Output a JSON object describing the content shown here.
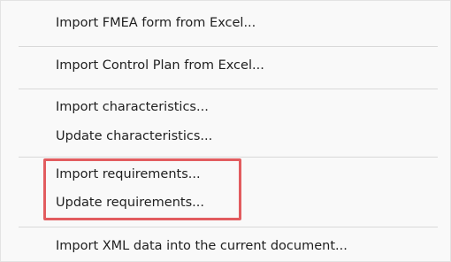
{
  "menu": {
    "items": [
      {
        "label": "Import FMEA form from Excel..."
      },
      {
        "label": "Import Control Plan from Excel..."
      },
      {
        "label": "Import characteristics..."
      },
      {
        "label": "Update characteristics..."
      },
      {
        "label": "Import requirements..."
      },
      {
        "label": "Update requirements..."
      },
      {
        "label": "Import XML data into the current document..."
      }
    ]
  },
  "colors": {
    "highlight_border": "#e25c5f",
    "separator": "#d9d9d9",
    "background": "#f9f9f9",
    "text": "#1f1f1f"
  }
}
